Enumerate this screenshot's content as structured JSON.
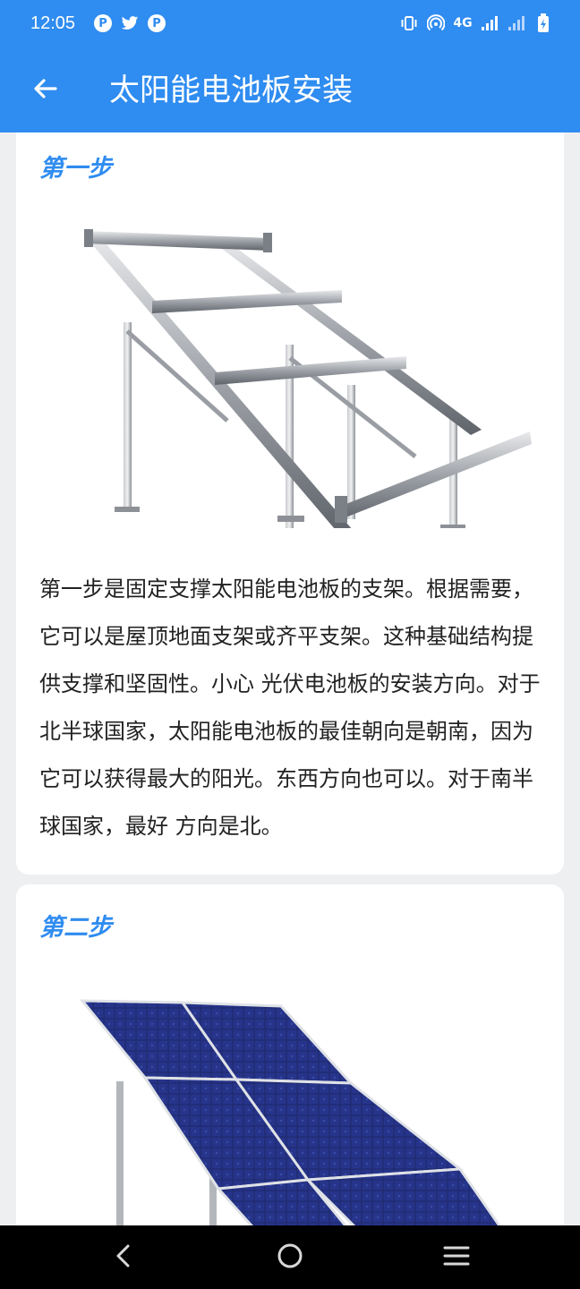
{
  "status_bar": {
    "time": "12:05",
    "left_icons": [
      "p-app-icon",
      "twitter-icon",
      "p-app-icon"
    ],
    "network": "4G"
  },
  "app_bar": {
    "title": "太阳能电池板安装"
  },
  "steps": [
    {
      "title": "第一步",
      "image": "solar-mounting-frame-image",
      "text": "第一步是固定支撑太阳能电池板的支架。根据需要，它可以是屋顶地面支架或齐平支架。这种基础结构提供支撑和坚固性。小心 光伏电池板的安装方向。对于北半球国家，太阳能电池板的最佳朝向是朝南，因为它可以获得最大的阳光。东西方向也可以。对于南半球国家，最好 方向是北。"
    },
    {
      "title": "第二步",
      "image": "solar-panels-on-frame-image",
      "text": ""
    }
  ],
  "colors": {
    "accent": "#2f8cf0",
    "background": "#eeeff1",
    "card": "#ffffff",
    "nav_bar": "#000000"
  }
}
